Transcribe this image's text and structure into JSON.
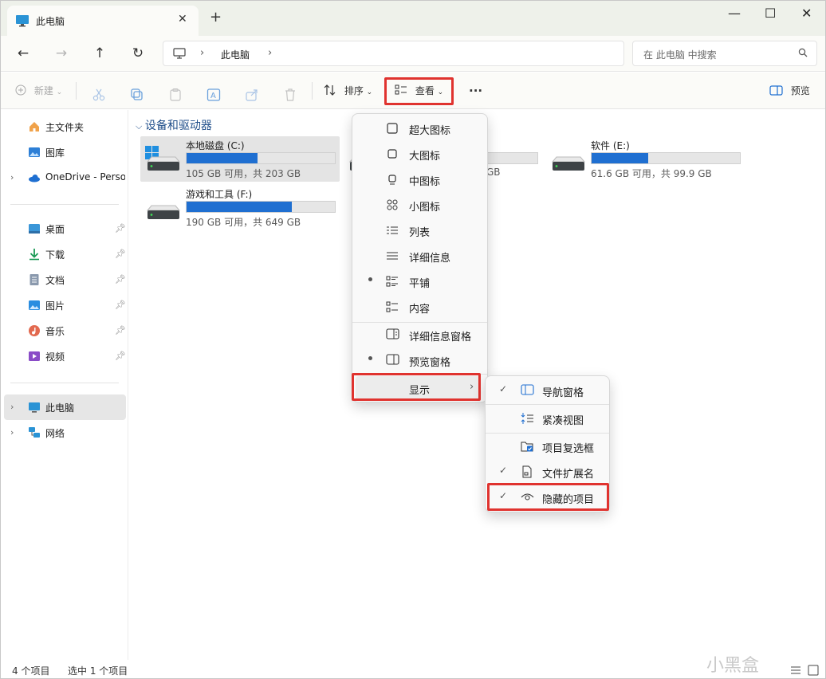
{
  "tab": {
    "title": "此电脑",
    "close": "✕",
    "new_tab": "+"
  },
  "window_controls": {
    "minimize": "—",
    "maximize": "☐",
    "close": "✕"
  },
  "nav": {
    "back": "←",
    "forward": "→",
    "up": "↑",
    "refresh": "↻"
  },
  "address": {
    "separator": "›",
    "location": "此电脑"
  },
  "search": {
    "placeholder": "在 此电脑 中搜索"
  },
  "toolbar": {
    "new_label": "新建",
    "sort_label": "排序",
    "view_label": "查看",
    "more_label": "···",
    "preview_label": "预览"
  },
  "sidebar": {
    "items": [
      {
        "label": "主文件夹",
        "icon": "home-icon"
      },
      {
        "label": "图库",
        "icon": "gallery-icon"
      },
      {
        "label": "OneDrive - Perso",
        "icon": "cloud-icon"
      },
      {
        "label": "桌面",
        "icon": "desktop-icon"
      },
      {
        "label": "下载",
        "icon": "download-icon"
      },
      {
        "label": "文档",
        "icon": "document-icon"
      },
      {
        "label": "图片",
        "icon": "pictures-icon"
      },
      {
        "label": "音乐",
        "icon": "music-icon"
      },
      {
        "label": "视频",
        "icon": "video-icon"
      },
      {
        "label": "此电脑",
        "icon": "computer-icon"
      },
      {
        "label": "网络",
        "icon": "network-icon"
      }
    ]
  },
  "main": {
    "group_title": "设备和驱动器",
    "drives": [
      {
        "name": "本地磁盘 (C:)",
        "size": "105 GB 可用，共 203 GB",
        "used_fraction": 0.48
      },
      {
        "name": "游戏和工具 (F:)",
        "size": "190 GB 可用，共 649 GB",
        "used_fraction": 0.71
      },
      {
        "name": "软件 (E:)",
        "size": "61.6 GB 可用，共 99.9 GB",
        "used_fraction": 0.38
      },
      {
        "name": "",
        "size": "GB",
        "used_fraction": 0.6
      }
    ]
  },
  "view_menu": {
    "items": [
      {
        "label": "超大图标",
        "icon": "extra-large-icons-icon"
      },
      {
        "label": "大图标",
        "icon": "large-icons-icon"
      },
      {
        "label": "中图标",
        "icon": "medium-icons-icon"
      },
      {
        "label": "小图标",
        "icon": "small-icons-icon"
      },
      {
        "label": "列表",
        "icon": "list-view-icon"
      },
      {
        "label": "详细信息",
        "icon": "details-view-icon"
      },
      {
        "label": "平铺",
        "icon": "tiles-view-icon",
        "selected": true
      },
      {
        "label": "内容",
        "icon": "content-view-icon"
      },
      {
        "label": "详细信息窗格",
        "icon": "details-pane-icon"
      },
      {
        "label": "预览窗格",
        "icon": "preview-pane-icon",
        "selected": true
      },
      {
        "label": "显示",
        "icon": "",
        "submenu": true
      }
    ]
  },
  "show_menu": {
    "items": [
      {
        "label": "导航窗格",
        "icon": "navigation-pane-icon",
        "checked": true
      },
      {
        "label": "紧凑视图",
        "icon": "compact-view-icon",
        "checked": false
      },
      {
        "label": "项目复选框",
        "icon": "item-checkbox-icon",
        "checked": false
      },
      {
        "label": "文件扩展名",
        "icon": "file-extension-icon",
        "checked": true
      },
      {
        "label": "隐藏的项目",
        "icon": "eye-icon",
        "checked": true
      }
    ],
    "check_glyph": "✓"
  },
  "status": {
    "item_count": "4 个项目",
    "selected": "选中 1 个项目"
  },
  "watermark": "小黑盒",
  "colors": {
    "accent": "#1f6fd1",
    "highlight_box": "#e0332f",
    "titlebar": "#eef1ea"
  }
}
